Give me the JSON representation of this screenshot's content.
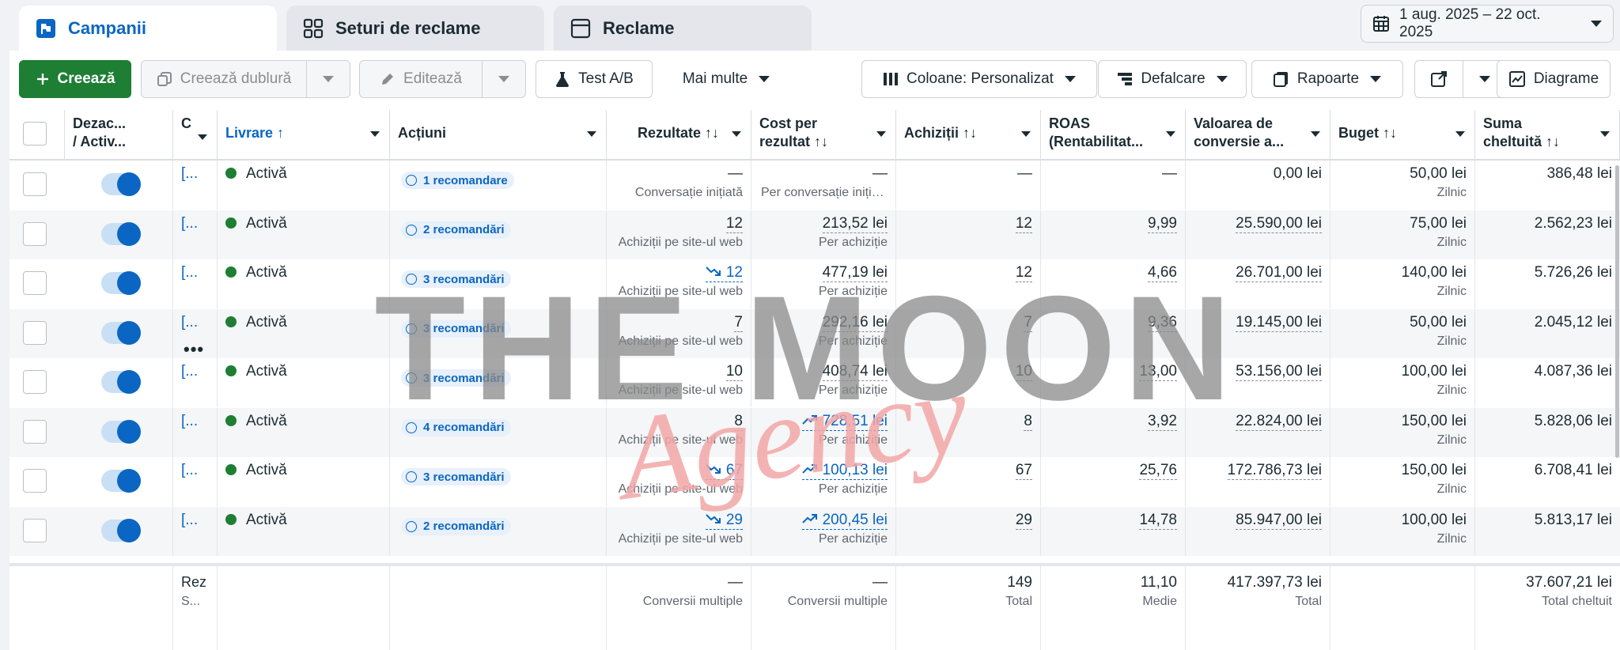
{
  "tabs": [
    {
      "label": "Campanii",
      "icon": "flag-icon"
    },
    {
      "label": "Seturi de reclame",
      "icon": "grid-icon"
    },
    {
      "label": "Reclame",
      "icon": "ad-icon"
    }
  ],
  "date_range": "1 aug. 2025 – 22 oct. 2025",
  "toolbar": {
    "create": "Creează",
    "duplicate": "Creează dublură",
    "edit": "Editează",
    "ab_test": "Test A/B",
    "more": "Mai multe",
    "columns": "Coloane: Personalizat",
    "breakdown": "Defalcare",
    "reports": "Rapoarte",
    "charts": "Diagrame"
  },
  "headers": {
    "toggle": "Dezac...\n/ Activ...",
    "name": "C",
    "delivery": "Livrare ↑",
    "actions": "Acțiuni",
    "results": "Rezultate ↑↓",
    "cost": "Cost per\nrezultat ↑↓",
    "purchases": "Achiziții ↑↓",
    "roas": "ROAS\n(Rentabilitat...",
    "conv_value": "Valoarea de\nconversie a...",
    "budget": "Buget ↑↓",
    "spent": "Suma\ncheltuită ↑↓"
  },
  "rows": [
    {
      "name": "[...",
      "status": "Activă",
      "rec": "1 recomandare",
      "results": "—",
      "results_sub": "Conversație inițiată",
      "results_trend": "",
      "cost": "—",
      "cost_sub": "Per conversație inițiată",
      "cost_trend": "",
      "purchases": "—",
      "roas": "—",
      "value": "0,00 lei",
      "budget": "50,00 lei",
      "budget_sub": "Zilnic",
      "spent": "386,48 lei"
    },
    {
      "name": "[...",
      "status": "Activă",
      "rec": "2 recomandări",
      "results": "12",
      "results_sub": "Achiziții pe site-ul web",
      "results_trend": "",
      "cost": "213,52 lei",
      "cost_sub": "Per achiziție",
      "cost_trend": "",
      "purchases": "12",
      "roas": "9,99",
      "value": "25.590,00 lei",
      "budget": "75,00 lei",
      "budget_sub": "Zilnic",
      "spent": "2.562,23 lei"
    },
    {
      "name": "[...",
      "status": "Activă",
      "rec": "3 recomandări",
      "results": "12",
      "results_sub": "Achiziții pe site-ul web",
      "results_trend": "down",
      "cost": "477,19 lei",
      "cost_sub": "Per achiziție",
      "cost_trend": "",
      "purchases": "12",
      "roas": "4,66",
      "value": "26.701,00 lei",
      "budget": "140,00 lei",
      "budget_sub": "Zilnic",
      "spent": "5.726,26 lei"
    },
    {
      "name": "[...",
      "status": "Activă",
      "rec": "3 recomandări",
      "results": "7",
      "results_sub": "Achiziții pe site-ul web",
      "results_trend": "",
      "cost": "292,16 lei",
      "cost_sub": "Per achiziție",
      "cost_trend": "",
      "purchases": "7",
      "roas": "9,36",
      "value": "19.145,00 lei",
      "budget": "50,00 lei",
      "budget_sub": "Zilnic",
      "spent": "2.045,12 lei"
    },
    {
      "name": "[...",
      "status": "Activă",
      "rec": "3 recomandări",
      "results": "10",
      "results_sub": "Achiziții pe site-ul web",
      "results_trend": "",
      "cost": "408,74 lei",
      "cost_sub": "Per achiziție",
      "cost_trend": "",
      "purchases": "10",
      "roas": "13,00",
      "value": "53.156,00 lei",
      "budget": "100,00 lei",
      "budget_sub": "Zilnic",
      "spent": "4.087,36 lei"
    },
    {
      "name": "[...",
      "status": "Activă",
      "rec": "4 recomandări",
      "results": "8",
      "results_sub": "Achiziții pe site-ul web",
      "results_trend": "",
      "cost": "728,51 lei",
      "cost_sub": "Per achiziție",
      "cost_trend": "up",
      "purchases": "8",
      "roas": "3,92",
      "value": "22.824,00 lei",
      "budget": "150,00 lei",
      "budget_sub": "Zilnic",
      "spent": "5.828,06 lei"
    },
    {
      "name": "[...",
      "status": "Activă",
      "rec": "3 recomandări",
      "results": "67",
      "results_sub": "Achiziții pe site-ul web",
      "results_trend": "down",
      "cost": "100,13 lei",
      "cost_sub": "Per achiziție",
      "cost_trend": "up",
      "purchases": "67",
      "roas": "25,76",
      "value": "172.786,73 lei",
      "budget": "150,00 lei",
      "budget_sub": "Zilnic",
      "spent": "6.708,41 lei"
    },
    {
      "name": "[...",
      "status": "Activă",
      "rec": "2 recomandări",
      "results": "29",
      "results_sub": "Achiziții pe site-ul web",
      "results_trend": "down",
      "cost": "200,45 lei",
      "cost_sub": "Per achiziție",
      "cost_trend": "up",
      "purchases": "29",
      "roas": "14,78",
      "value": "85.947,00 lei",
      "budget": "100,00 lei",
      "budget_sub": "Zilnic",
      "spent": "5.813,17 lei"
    }
  ],
  "footer": {
    "name": "Rez",
    "name_sub": "S...",
    "results": "—",
    "results_sub": "Conversii multiple",
    "cost": "—",
    "cost_sub": "Conversii multiple",
    "purchases": "149",
    "purchases_sub": "Total",
    "roas": "11,10",
    "roas_sub": "Medie",
    "value": "417.397,73 lei",
    "value_sub": "Total",
    "spent": "37.607,21 lei",
    "spent_sub": "Total cheltuit"
  },
  "watermark": {
    "line1": "THE MOON",
    "line2": "Agency"
  },
  "colors": {
    "accent": "#0a66c2",
    "create": "#1e7e34",
    "status_active": "#1e7e34",
    "watermark_gray": "#8a8a8a",
    "watermark_pink": "#f2a6a6"
  }
}
